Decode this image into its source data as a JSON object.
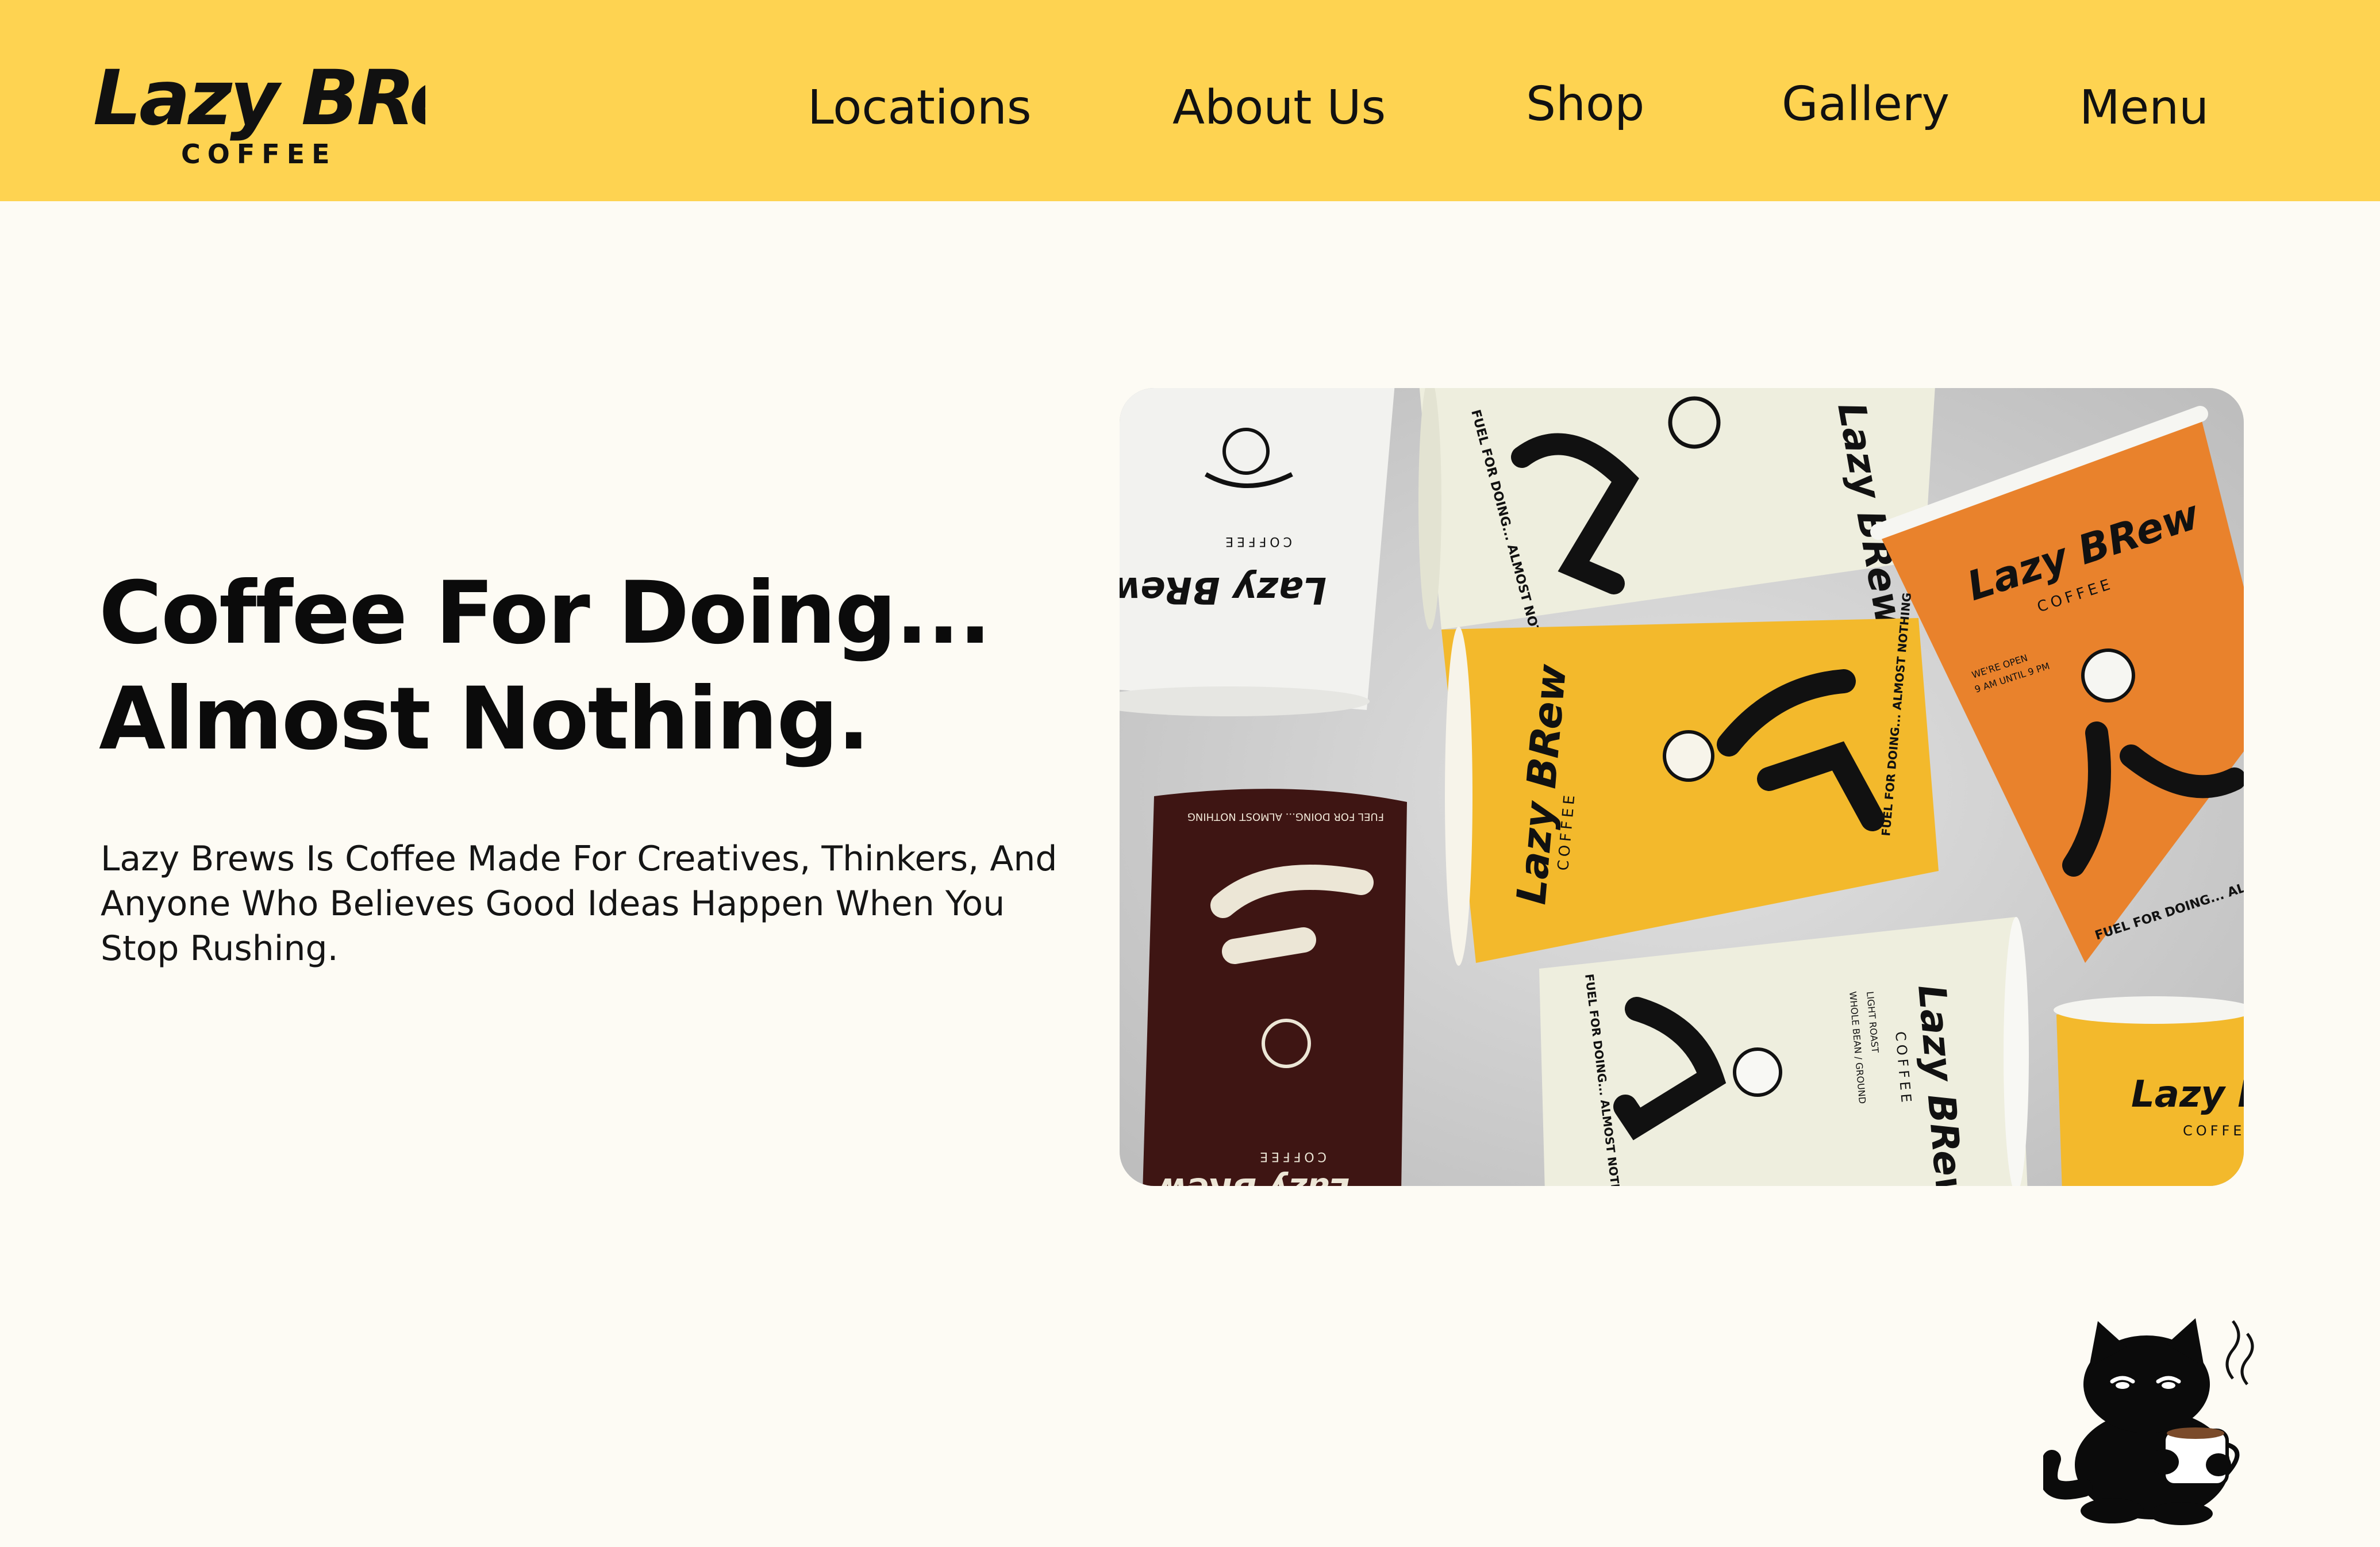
{
  "brand": {
    "logo_text": "Lazy BRew",
    "logo_subtext": "COFFEE"
  },
  "nav": {
    "items": [
      {
        "label": "Locations"
      },
      {
        "label": "About Us"
      },
      {
        "label": "Shop"
      },
      {
        "label": "Gallery"
      },
      {
        "label": "Menu"
      }
    ]
  },
  "hero": {
    "headline_line1": "Coffee For Doing...",
    "headline_line2": "Almost Nothing.",
    "description": "Lazy Brews Is Coffee Made For Creatives, Thinkers, And Anyone Who Believes Good Ideas Happen When You Stop Rushing.",
    "image": {
      "cup_brand": "Lazy BRew",
      "cup_sub": "COFFEE",
      "cup_tagline": "FUEL FOR DOING... ALMOST NOTHING",
      "cup_hours_1": "WE'RE OPEN",
      "cup_hours_2": "9 AM UNTIL 9 PM",
      "cup_roast_1": "WHOLE BEAN / GROUND",
      "cup_roast_2": "LIGHT ROAST"
    }
  },
  "mascot": {
    "icon": "cat-with-coffee-icon"
  },
  "colors": {
    "header_bg": "#fed351",
    "page_bg": "#fdfbf4",
    "text": "#0b0b0b",
    "cup_yellow": "#f3b92c",
    "cup_orange": "#e9822c",
    "cup_brown": "#3e1513",
    "cup_cream": "#eeeede"
  }
}
